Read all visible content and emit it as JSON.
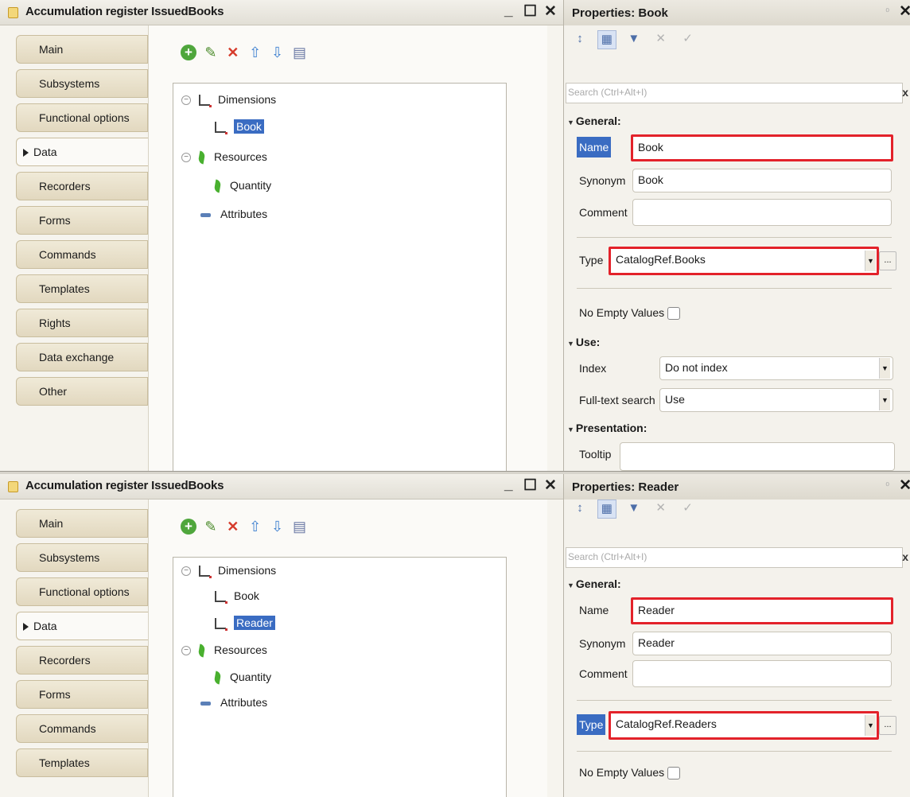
{
  "top": {
    "window_title": "Accumulation register IssuedBooks",
    "tabs": [
      "Main",
      "Subsystems",
      "Functional options",
      "Data",
      "Recorders",
      "Forms",
      "Commands",
      "Templates",
      "Rights",
      "Data exchange",
      "Other"
    ],
    "active_tab": "Data",
    "tree": {
      "dimensions_label": "Dimensions",
      "dimensions": [
        "Book"
      ],
      "resources_label": "Resources",
      "resources": [
        "Quantity"
      ],
      "attributes_label": "Attributes"
    },
    "properties": {
      "title": "Properties: Book",
      "search_placeholder": "Search (Ctrl+Alt+I)",
      "general_label": "General:",
      "name_label": "Name",
      "name_value": "Book",
      "synonym_label": "Synonym",
      "synonym_value": "Book",
      "comment_label": "Comment",
      "comment_value": "",
      "type_label": "Type",
      "type_value": "CatalogRef.Books",
      "no_empty_label": "No Empty Values",
      "use_label": "Use:",
      "index_label": "Index",
      "index_value": "Do not index",
      "fulltext_label": "Full-text search",
      "fulltext_value": "Use",
      "presentation_label": "Presentation:",
      "tooltip_label": "Tooltip"
    }
  },
  "bottom": {
    "window_title": "Accumulation register IssuedBooks",
    "tabs": [
      "Main",
      "Subsystems",
      "Functional options",
      "Data",
      "Recorders",
      "Forms",
      "Commands",
      "Templates"
    ],
    "active_tab": "Data",
    "tree": {
      "dimensions_label": "Dimensions",
      "dimensions": [
        "Book",
        "Reader"
      ],
      "resources_label": "Resources",
      "resources": [
        "Quantity"
      ],
      "attributes_label": "Attributes"
    },
    "properties": {
      "title": "Properties: Reader",
      "search_placeholder": "Search (Ctrl+Alt+I)",
      "general_label": "General:",
      "name_label": "Name",
      "name_value": "Reader",
      "synonym_label": "Synonym",
      "synonym_value": "Reader",
      "comment_label": "Comment",
      "comment_value": "",
      "type_label": "Type",
      "type_value": "CatalogRef.Readers",
      "no_empty_label": "No Empty Values"
    }
  },
  "colors": {
    "highlight": "#e3222a",
    "selection": "#3a6cc2"
  }
}
